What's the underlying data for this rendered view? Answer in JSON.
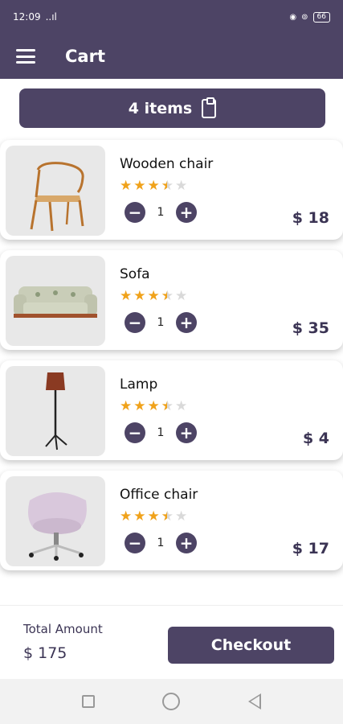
{
  "status_bar": {
    "time": "12:09",
    "signal": "..ıl",
    "battery": "66"
  },
  "app_bar": {
    "title": "Cart",
    "menu_icon": "hamburger-menu-icon"
  },
  "cart_summary": {
    "count_label": "4 items",
    "icon": "clipboard-icon"
  },
  "items": [
    {
      "name": "Wooden chair",
      "rating": 3.5,
      "quantity": "1",
      "price": "$ 18",
      "image": "wooden-chair-image"
    },
    {
      "name": "Sofa",
      "rating": 3.5,
      "quantity": "1",
      "price": "$ 35",
      "image": "sofa-image"
    },
    {
      "name": "Lamp",
      "rating": 3.5,
      "quantity": "1",
      "price": "$ 4",
      "image": "lamp-image"
    },
    {
      "name": "Office chair",
      "rating": 3.5,
      "quantity": "1",
      "price": "$ 17",
      "image": "office-chair-image"
    }
  ],
  "quantity_controls": {
    "decrement": "−",
    "increment": "+"
  },
  "footer": {
    "total_label": "Total Amount",
    "total_value": "$ 175",
    "checkout_label": "Checkout"
  },
  "colors": {
    "primary": "#4d4465",
    "star": "#f0a21a",
    "star_empty": "#d9d9d9",
    "price_text": "#3b3454"
  }
}
